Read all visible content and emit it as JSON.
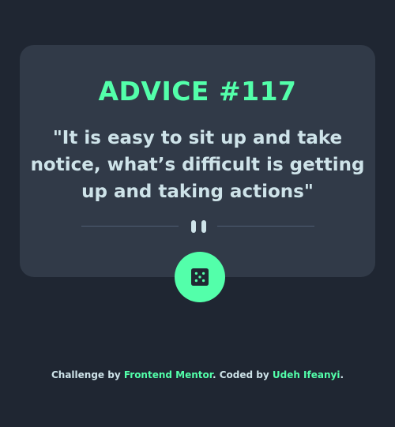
{
  "card": {
    "title": "ADVICE #117",
    "quote": "\"It is easy to sit up and take notice, what’s difficult is getting up and taking actions\""
  },
  "divider": {
    "icon": "pause-icon"
  },
  "dice_button": {
    "icon": "dice-icon"
  },
  "footer": {
    "prefix": "Challenge by ",
    "challenge_link": "Frontend Mentor",
    "middle": ". Coded by ",
    "author_link": "Udeh Ifeanyi",
    "suffix": "."
  },
  "colors": {
    "background": "#1f2632",
    "card": "#313a48",
    "accent": "#53ffaa",
    "text": "#cee3e9",
    "divider": "#4f5d74"
  }
}
